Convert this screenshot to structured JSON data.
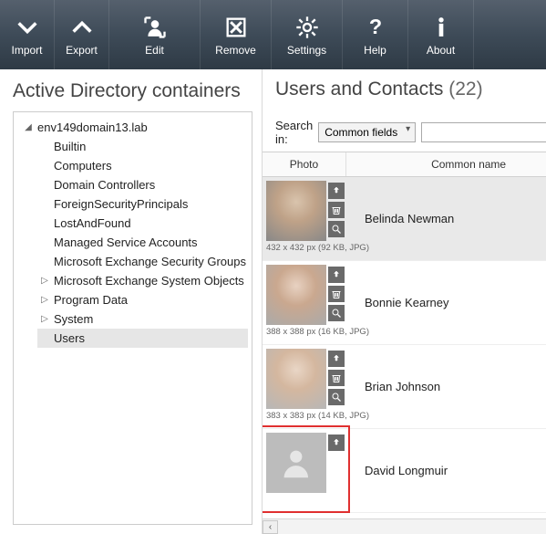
{
  "toolbar": {
    "import": "Import",
    "export": "Export",
    "edit": "Edit",
    "remove": "Remove",
    "settings": "Settings",
    "help": "Help",
    "about": "About"
  },
  "left": {
    "title": "Active Directory containers",
    "root": "env149domain13.lab",
    "children": [
      {
        "label": "Builtin",
        "expander": ""
      },
      {
        "label": "Computers",
        "expander": ""
      },
      {
        "label": "Domain Controllers",
        "expander": ""
      },
      {
        "label": "ForeignSecurityPrincipals",
        "expander": ""
      },
      {
        "label": "LostAndFound",
        "expander": ""
      },
      {
        "label": "Managed Service Accounts",
        "expander": ""
      },
      {
        "label": "Microsoft Exchange Security Groups",
        "expander": ""
      },
      {
        "label": "Microsoft Exchange System Objects",
        "expander": "▷"
      },
      {
        "label": "Program Data",
        "expander": "▷"
      },
      {
        "label": "System",
        "expander": "▷"
      },
      {
        "label": "Users",
        "expander": "",
        "selected": true
      }
    ]
  },
  "right": {
    "title": "Users and Contacts",
    "count": "(22)",
    "search_label": "Search in:",
    "search_field_sel": "Common fields",
    "columns": {
      "photo": "Photo",
      "name": "Common name"
    },
    "rows": [
      {
        "name": "Belinda Newman",
        "meta": "432 x 432 px (92 KB, JPG)",
        "selected": true,
        "has_photo": true
      },
      {
        "name": "Bonnie Kearney",
        "meta": "388 x 388 px (16 KB, JPG)",
        "has_photo": true
      },
      {
        "name": "Brian Johnson",
        "meta": "383 x 383 px (14 KB, JPG)",
        "has_photo": true
      },
      {
        "name": "David Longmuir",
        "meta": "",
        "has_photo": false,
        "highlighted": true
      }
    ]
  }
}
